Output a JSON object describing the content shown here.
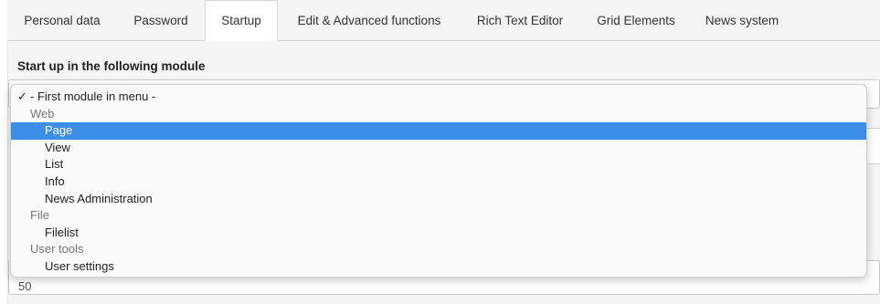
{
  "tabs": [
    {
      "label": "Personal data"
    },
    {
      "label": "Password"
    },
    {
      "label": "Startup",
      "active": true
    },
    {
      "label": "Edit & Advanced functions"
    },
    {
      "label": "Rich Text Editor"
    },
    {
      "label": "Grid Elements"
    },
    {
      "label": "News system"
    }
  ],
  "section": {
    "title": "Start up in the following module"
  },
  "dropdown": {
    "check_glyph": "✓",
    "first_option": "- First module in menu -",
    "groups": [
      {
        "label": "Web",
        "items": [
          "Page",
          "View",
          "List",
          "Info",
          "News Administration"
        ]
      },
      {
        "label": "File",
        "items": [
          "Filelist"
        ]
      },
      {
        "label": "User tools",
        "items": [
          "User settings"
        ]
      }
    ],
    "highlighted": "Page",
    "highlight_color": "#3d8ee6"
  },
  "lower_field": {
    "value": "50"
  }
}
